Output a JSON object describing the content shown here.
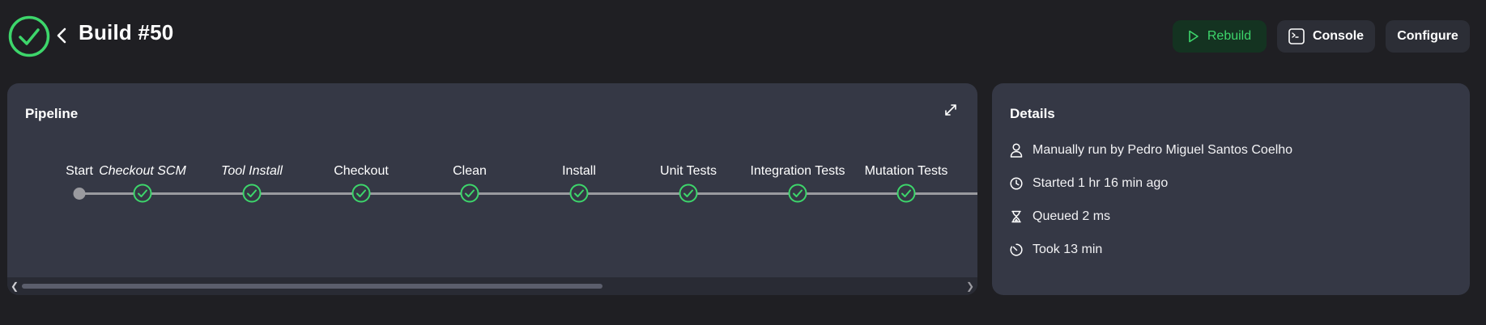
{
  "header": {
    "title": "Build #50",
    "status": "success",
    "buttons": {
      "rebuild": "Rebuild",
      "console": "Console",
      "configure": "Configure"
    }
  },
  "pipeline": {
    "title": "Pipeline",
    "stages": [
      {
        "label": "Start",
        "status": "start",
        "italic": false
      },
      {
        "label": "Checkout SCM",
        "status": "success",
        "italic": true
      },
      {
        "label": "Tool Install",
        "status": "success",
        "italic": true
      },
      {
        "label": "Checkout",
        "status": "success",
        "italic": false
      },
      {
        "label": "Clean",
        "status": "success",
        "italic": false
      },
      {
        "label": "Install",
        "status": "success",
        "italic": false
      },
      {
        "label": "Unit Tests",
        "status": "success",
        "italic": false
      },
      {
        "label": "Integration Tests",
        "status": "success",
        "italic": false
      },
      {
        "label": "Mutation Tests",
        "status": "success",
        "italic": false
      }
    ]
  },
  "details": {
    "title": "Details",
    "items": [
      {
        "icon": "user-icon",
        "text": "Manually run by Pedro Miguel Santos Coelho"
      },
      {
        "icon": "clock-icon",
        "text": "Started 1 hr 16 min ago"
      },
      {
        "icon": "hourglass-icon",
        "text": "Queued 2 ms"
      },
      {
        "icon": "timer-icon",
        "text": "Took 13 min"
      }
    ]
  },
  "colors": {
    "success": "#3dd66b",
    "background": "#1f1f23",
    "card": "#353845"
  }
}
